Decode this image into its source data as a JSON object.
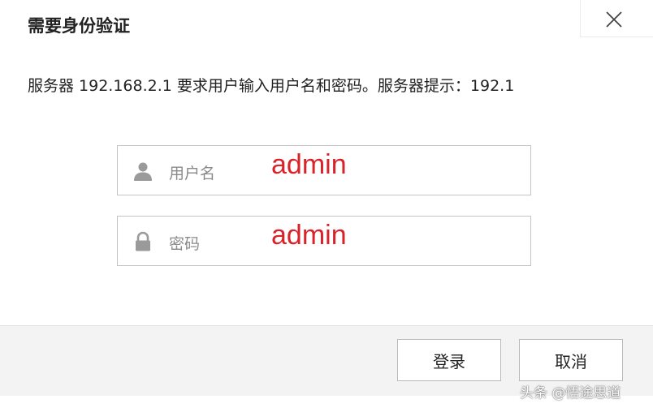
{
  "dialog": {
    "title": "需要身份验证",
    "message": "服务器 192.168.2.1 要求用户输入用户名和密码。服务器提示：192.1",
    "close_icon": "close-icon"
  },
  "fields": {
    "username": {
      "icon": "user-icon",
      "placeholder": "用户名",
      "value": "admin"
    },
    "password": {
      "icon": "lock-icon",
      "placeholder": "密码",
      "value": "admin"
    }
  },
  "buttons": {
    "login_label": "登录",
    "cancel_label": "取消"
  },
  "watermark": "头条 @悟途思道",
  "colors": {
    "annotation_red": "#d9232a",
    "placeholder_gray": "#8a8a8a",
    "footer_bg": "#f3f3f3"
  }
}
